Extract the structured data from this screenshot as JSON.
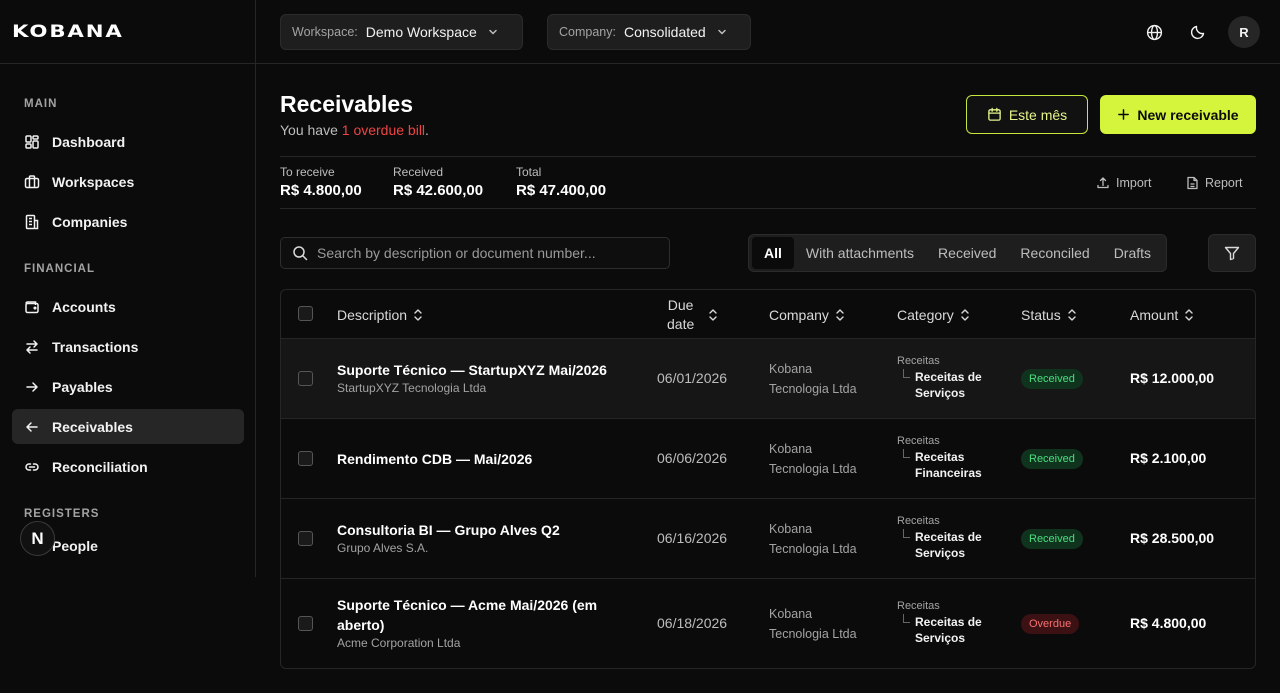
{
  "brand": {
    "logo": "KOBANA"
  },
  "sidebar": {
    "sections": [
      {
        "title": "MAIN",
        "items": [
          {
            "label": "Dashboard",
            "icon": "dashboard-icon"
          },
          {
            "label": "Workspaces",
            "icon": "briefcase-icon"
          },
          {
            "label": "Companies",
            "icon": "building-icon"
          }
        ]
      },
      {
        "title": "FINANCIAL",
        "items": [
          {
            "label": "Accounts",
            "icon": "wallet-icon"
          },
          {
            "label": "Transactions",
            "icon": "arrows-swap-icon"
          },
          {
            "label": "Payables",
            "icon": "arrow-right-icon"
          },
          {
            "label": "Receivables",
            "icon": "arrow-left-icon",
            "active": true
          },
          {
            "label": "Reconciliation",
            "icon": "link-icon"
          }
        ]
      },
      {
        "title": "REGISTERS",
        "items": [
          {
            "label": "People",
            "icon": "users-icon"
          }
        ]
      }
    ],
    "floating_badge": "N"
  },
  "topbar": {
    "workspace": {
      "label": "Workspace:",
      "value": "Demo Workspace"
    },
    "company": {
      "label": "Company:",
      "value": "Consolidated"
    },
    "avatar": "R"
  },
  "page": {
    "title": "Receivables",
    "subtitle_prefix": "You have ",
    "subtitle_highlight": "1 overdue bill",
    "subtitle_suffix": ".",
    "period_button": "Este mês",
    "new_button": "New receivable",
    "stats": [
      {
        "label": "To receive",
        "value": "R$ 4.800,00"
      },
      {
        "label": "Received",
        "value": "R$ 42.600,00"
      },
      {
        "label": "Total",
        "value": "R$ 47.400,00"
      }
    ],
    "import_label": "Import",
    "report_label": "Report",
    "search_placeholder": "Search by description or document number...",
    "tabs": [
      "All",
      "With attachments",
      "Received",
      "Reconciled",
      "Drafts"
    ],
    "active_tab": "All"
  },
  "table": {
    "headers": {
      "description": "Description",
      "due_line1": "Due",
      "due_line2": "date",
      "company": "Company",
      "category": "Category",
      "status": "Status",
      "amount": "Amount"
    },
    "rows": [
      {
        "title": "Suporte Técnico — StartupXYZ Mai/2026",
        "sub": "StartupXYZ Tecnologia Ltda",
        "due": "06/01/2026",
        "company_l1": "Kobana",
        "company_l2": "Tecnologia Ltda",
        "cat_parent": "Receitas",
        "cat_l1": "Receitas de",
        "cat_l2": "Serviços",
        "status": "Received",
        "status_color": "#4ade80",
        "amount": "R$ 12.000,00"
      },
      {
        "title": "Rendimento CDB — Mai/2026",
        "sub": "",
        "due": "06/06/2026",
        "company_l1": "Kobana",
        "company_l2": "Tecnologia Ltda",
        "cat_parent": "Receitas",
        "cat_l1": "Receitas",
        "cat_l2": "Financeiras",
        "status": "Received",
        "status_color": "#4ade80",
        "amount": "R$ 2.100,00"
      },
      {
        "title": "Consultoria BI — Grupo Alves Q2",
        "sub": "Grupo Alves S.A.",
        "due": "06/16/2026",
        "company_l1": "Kobana",
        "company_l2": "Tecnologia Ltda",
        "cat_parent": "Receitas",
        "cat_l1": "Receitas de",
        "cat_l2": "Serviços",
        "status": "Received",
        "status_color": "#4ade80",
        "amount": "R$ 28.500,00"
      },
      {
        "title_l1": "Suporte Técnico — Acme Mai/2026 (em",
        "title_l2": "aberto)",
        "sub": "Acme Corporation Ltda",
        "due": "06/18/2026",
        "company_l1": "Kobana",
        "company_l2": "Tecnologia Ltda",
        "cat_parent": "Receitas",
        "cat_l1": "Receitas de",
        "cat_l2": "Serviços",
        "status": "Overdue",
        "status_color": "#f87171",
        "amount": "R$ 4.800,00"
      }
    ]
  },
  "colors": {
    "accent": "#d4f53c",
    "background": "#0b0b0b",
    "danger": "#ef4444"
  }
}
